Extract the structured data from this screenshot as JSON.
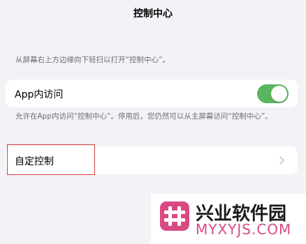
{
  "nav": {
    "title": "控制中心"
  },
  "section": {
    "header": "从屏幕右上方边缘向下轻扫以打开“控制中心”。"
  },
  "app_access": {
    "label": "App内访问",
    "toggle_on": true,
    "footer": "允许在App内访问“控制中心”。停用后，您仍然可以从主屏幕访问“控制中心”。"
  },
  "customize": {
    "label": "自定控制"
  },
  "watermark": {
    "name": "兴业软件园",
    "url": "MYXYJS.COM"
  },
  "colors": {
    "toggle_on": "#5ab55e",
    "highlight": "#d9403a",
    "watermark_accent": "#d94a85"
  },
  "icons": {
    "chevron": "chevron-right-icon",
    "logo": "hash-logo-icon"
  }
}
